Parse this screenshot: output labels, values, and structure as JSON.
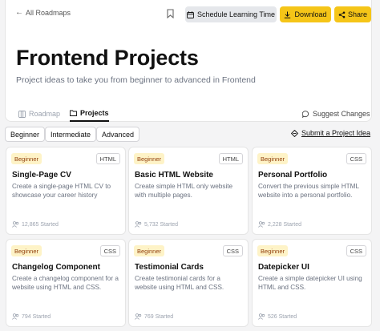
{
  "header": {
    "back_label": "All Roadmaps",
    "schedule_label": "Schedule Learning Time",
    "download_label": "Download",
    "share_label": "Share",
    "title": "Frontend Projects",
    "subtitle": "Project ideas to take you from beginner to advanced in Frontend"
  },
  "tabs": {
    "roadmap": "Roadmap",
    "projects": "Projects",
    "suggest": "Suggest Changes"
  },
  "filters": {
    "beginner": "Beginner",
    "intermediate": "Intermediate",
    "advanced": "Advanced",
    "submit": "Submit a Project Idea"
  },
  "projects": [
    {
      "level": "Beginner",
      "tech": "HTML",
      "title": "Single-Page CV",
      "desc": "Create a single-page HTML CV to showcase your career history",
      "started": "12,865 Started"
    },
    {
      "level": "Beginner",
      "tech": "HTML",
      "title": "Basic HTML Website",
      "desc": "Create simple HTML only website with multiple pages.",
      "started": "5,732 Started"
    },
    {
      "level": "Beginner",
      "tech": "CSS",
      "title": "Personal Portfolio",
      "desc": "Convert the previous simple HTML website into a personal portfolio.",
      "started": "2,228 Started"
    },
    {
      "level": "Beginner",
      "tech": "CSS",
      "title": "Changelog Component",
      "desc": "Create a changelog component for a website using HTML and CSS.",
      "started": "794 Started"
    },
    {
      "level": "Beginner",
      "tech": "CSS",
      "title": "Testimonial Cards",
      "desc": "Create testimonial cards for a website using HTML and CSS.",
      "started": "769 Started"
    },
    {
      "level": "Beginner",
      "tech": "CSS",
      "title": "Datepicker UI",
      "desc": "Create a simple datepicker UI using HTML and CSS.",
      "started": "526 Started"
    }
  ]
}
